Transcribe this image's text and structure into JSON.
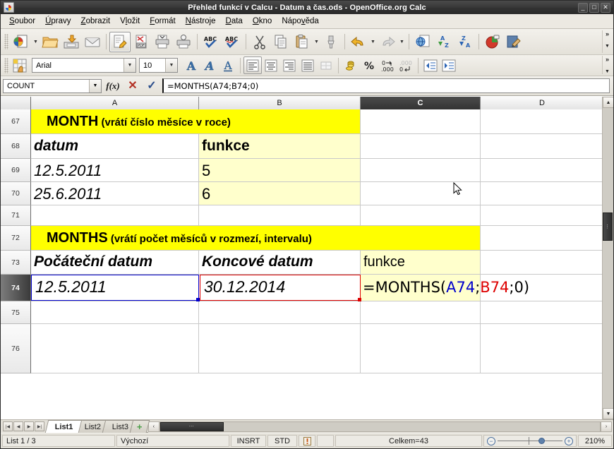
{
  "window": {
    "title": "Přehled funkcí v Calcu - Datum a čas.ods - OpenOffice.org Calc",
    "app_icon": "calc-document-icon",
    "minimize": "_",
    "maximize": "□",
    "close": "✕"
  },
  "menu": [
    {
      "label": "Soubor",
      "name": "menu-soubor"
    },
    {
      "label": "Úpravy",
      "name": "menu-upravy"
    },
    {
      "label": "Zobrazit",
      "name": "menu-zobrazit"
    },
    {
      "label": "Vložit",
      "name": "menu-vlozit"
    },
    {
      "label": "Formát",
      "name": "menu-format"
    },
    {
      "label": "Nástroje",
      "name": "menu-nastroje"
    },
    {
      "label": "Data",
      "name": "menu-data"
    },
    {
      "label": "Okno",
      "name": "menu-okno"
    },
    {
      "label": "Nápověda",
      "name": "menu-napoveda"
    }
  ],
  "standard_toolbar": {
    "overflow_label": "»",
    "items": [
      "new-document-icon",
      "new-document-dropdown-icon",
      "open-icon",
      "save-icon",
      "email-document-icon",
      "edit-file-icon",
      "export-pdf-icon",
      "print-icon",
      "print-preview-icon",
      "spelling-icon",
      "autospellcheck-icon",
      "cut-icon",
      "copy-icon",
      "paste-icon",
      "paste-dropdown-icon",
      "clone-formatting-icon",
      "undo-icon",
      "undo-dropdown-icon",
      "redo-icon",
      "redo-dropdown-icon",
      "hyperlink-icon",
      "sort-ascending-icon",
      "sort-descending-icon",
      "insert-chart-icon",
      "show-draw-functions-icon"
    ]
  },
  "format_toolbar": {
    "styles_icon": "styles-and-formatting-icon",
    "font_name": "Arial",
    "font_size": "10",
    "overflow_label": "»",
    "items": [
      "bold-icon",
      "italic-icon",
      "underline-icon",
      "align-left-icon",
      "align-center-icon",
      "align-right-icon",
      "align-justified-icon",
      "merge-cells-icon",
      "currency-format-icon",
      "percent-format-icon",
      "add-decimal-icon",
      "delete-decimal-icon",
      "decrease-indent-icon",
      "increase-indent-icon"
    ]
  },
  "formula_bar": {
    "name_box_value": "COUNT",
    "function_wizard_label": "f(x)",
    "cancel_label": "✕",
    "accept_label": "✓",
    "input_value": "=MONTHS(A74;B74;0)"
  },
  "sheet": {
    "columns": [
      {
        "label": "A",
        "name": "column-header-a",
        "selected": false
      },
      {
        "label": "B",
        "name": "column-header-b",
        "selected": false
      },
      {
        "label": "C",
        "name": "column-header-c",
        "selected": true
      },
      {
        "label": "D",
        "name": "column-header-d",
        "selected": false
      }
    ],
    "rows": [
      {
        "label": "67",
        "selected": false
      },
      {
        "label": "68",
        "selected": false
      },
      {
        "label": "69",
        "selected": false
      },
      {
        "label": "70",
        "selected": false
      },
      {
        "label": "71",
        "selected": false
      },
      {
        "label": "72",
        "selected": false
      },
      {
        "label": "73",
        "selected": false
      },
      {
        "label": "74",
        "selected": true
      },
      {
        "label": "75",
        "selected": false
      },
      {
        "label": "76",
        "selected": false
      }
    ],
    "cells": {
      "a67_heading": "MONTH",
      "a67_desc": " (vrátí číslo měsíce v roce)",
      "a68": "datum",
      "b68": "funkce",
      "a69": "12.5.2011",
      "b69": "5",
      "a70": "25.6.2011",
      "b70": "6",
      "a72_heading": "MONTHS",
      "a72_desc": " (vrátí počet měsíců v rozmezí, intervalu)",
      "a73": "Počáteční datum",
      "b73": "Koncové datum",
      "c73": "funkce",
      "a74": "12.5.2011",
      "b74": "30.12.2014",
      "c74_part1": "=MONTHS(",
      "c74_ref1": "A74",
      "c74_sep": ";",
      "c74_ref2": "B74",
      "c74_part2": ";0)"
    },
    "colors": {
      "highlight_yellow": "#FFFF00",
      "soft_yellow": "#FFFFCC",
      "ref1_blue": "#0000CC",
      "ref2_red": "#DD0000",
      "gridline": "#C9C9C9"
    }
  },
  "sheet_tabs": {
    "nav": [
      "first-sheet-icon",
      "previous-sheet-icon",
      "next-sheet-icon",
      "last-sheet-icon"
    ],
    "tabs": [
      {
        "label": "List1",
        "selected": true
      },
      {
        "label": "List2",
        "selected": false
      },
      {
        "label": "List3",
        "selected": false
      }
    ],
    "add_label": "+"
  },
  "scrollbars": {
    "up_arrow": "▲",
    "down_arrow": "▼",
    "left_arrow": "‹",
    "right_arrow": "›",
    "grip": "⋮"
  },
  "status_bar": {
    "sheet_position": "List 1 / 3",
    "page_style": "Výchozí",
    "insert_mode": "INSRT",
    "selection_mode": "STD",
    "modified_icon": "document-modified-icon",
    "signature": "",
    "selection_info": "Celkem=43",
    "zoom_out_label": "−",
    "zoom_in_label": "+",
    "zoom_level": "210%"
  }
}
